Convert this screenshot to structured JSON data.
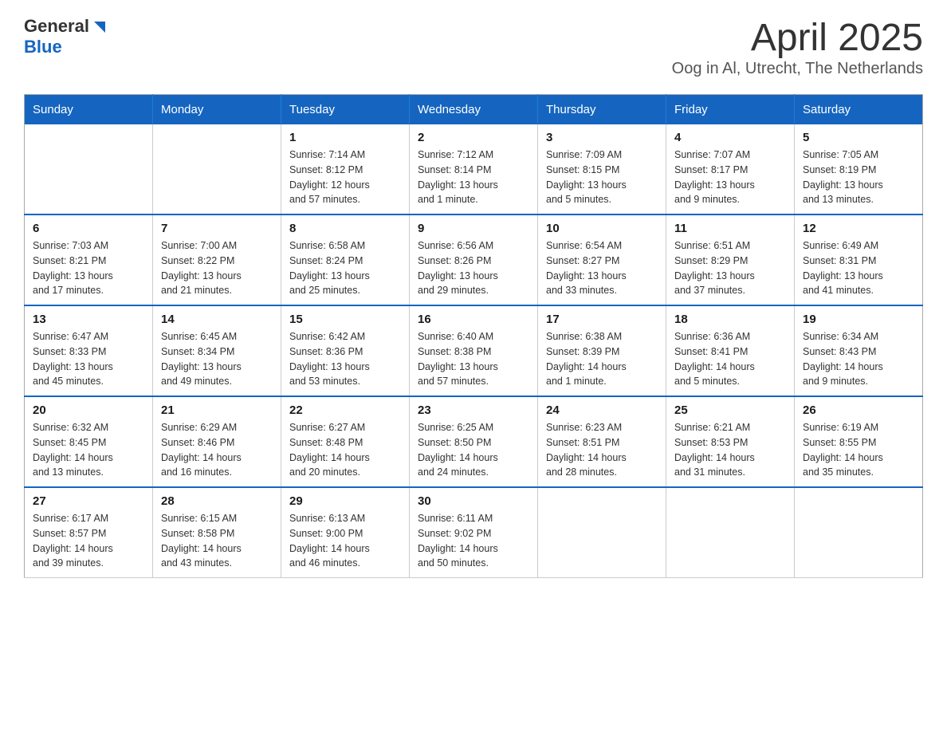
{
  "header": {
    "logo_general": "General",
    "logo_blue": "Blue",
    "main_title": "April 2025",
    "subtitle": "Oog in Al, Utrecht, The Netherlands"
  },
  "calendar": {
    "days_of_week": [
      "Sunday",
      "Monday",
      "Tuesday",
      "Wednesday",
      "Thursday",
      "Friday",
      "Saturday"
    ],
    "weeks": [
      [
        {
          "day": "",
          "info": ""
        },
        {
          "day": "",
          "info": ""
        },
        {
          "day": "1",
          "info": "Sunrise: 7:14 AM\nSunset: 8:12 PM\nDaylight: 12 hours\nand 57 minutes."
        },
        {
          "day": "2",
          "info": "Sunrise: 7:12 AM\nSunset: 8:14 PM\nDaylight: 13 hours\nand 1 minute."
        },
        {
          "day": "3",
          "info": "Sunrise: 7:09 AM\nSunset: 8:15 PM\nDaylight: 13 hours\nand 5 minutes."
        },
        {
          "day": "4",
          "info": "Sunrise: 7:07 AM\nSunset: 8:17 PM\nDaylight: 13 hours\nand 9 minutes."
        },
        {
          "day": "5",
          "info": "Sunrise: 7:05 AM\nSunset: 8:19 PM\nDaylight: 13 hours\nand 13 minutes."
        }
      ],
      [
        {
          "day": "6",
          "info": "Sunrise: 7:03 AM\nSunset: 8:21 PM\nDaylight: 13 hours\nand 17 minutes."
        },
        {
          "day": "7",
          "info": "Sunrise: 7:00 AM\nSunset: 8:22 PM\nDaylight: 13 hours\nand 21 minutes."
        },
        {
          "day": "8",
          "info": "Sunrise: 6:58 AM\nSunset: 8:24 PM\nDaylight: 13 hours\nand 25 minutes."
        },
        {
          "day": "9",
          "info": "Sunrise: 6:56 AM\nSunset: 8:26 PM\nDaylight: 13 hours\nand 29 minutes."
        },
        {
          "day": "10",
          "info": "Sunrise: 6:54 AM\nSunset: 8:27 PM\nDaylight: 13 hours\nand 33 minutes."
        },
        {
          "day": "11",
          "info": "Sunrise: 6:51 AM\nSunset: 8:29 PM\nDaylight: 13 hours\nand 37 minutes."
        },
        {
          "day": "12",
          "info": "Sunrise: 6:49 AM\nSunset: 8:31 PM\nDaylight: 13 hours\nand 41 minutes."
        }
      ],
      [
        {
          "day": "13",
          "info": "Sunrise: 6:47 AM\nSunset: 8:33 PM\nDaylight: 13 hours\nand 45 minutes."
        },
        {
          "day": "14",
          "info": "Sunrise: 6:45 AM\nSunset: 8:34 PM\nDaylight: 13 hours\nand 49 minutes."
        },
        {
          "day": "15",
          "info": "Sunrise: 6:42 AM\nSunset: 8:36 PM\nDaylight: 13 hours\nand 53 minutes."
        },
        {
          "day": "16",
          "info": "Sunrise: 6:40 AM\nSunset: 8:38 PM\nDaylight: 13 hours\nand 57 minutes."
        },
        {
          "day": "17",
          "info": "Sunrise: 6:38 AM\nSunset: 8:39 PM\nDaylight: 14 hours\nand 1 minute."
        },
        {
          "day": "18",
          "info": "Sunrise: 6:36 AM\nSunset: 8:41 PM\nDaylight: 14 hours\nand 5 minutes."
        },
        {
          "day": "19",
          "info": "Sunrise: 6:34 AM\nSunset: 8:43 PM\nDaylight: 14 hours\nand 9 minutes."
        }
      ],
      [
        {
          "day": "20",
          "info": "Sunrise: 6:32 AM\nSunset: 8:45 PM\nDaylight: 14 hours\nand 13 minutes."
        },
        {
          "day": "21",
          "info": "Sunrise: 6:29 AM\nSunset: 8:46 PM\nDaylight: 14 hours\nand 16 minutes."
        },
        {
          "day": "22",
          "info": "Sunrise: 6:27 AM\nSunset: 8:48 PM\nDaylight: 14 hours\nand 20 minutes."
        },
        {
          "day": "23",
          "info": "Sunrise: 6:25 AM\nSunset: 8:50 PM\nDaylight: 14 hours\nand 24 minutes."
        },
        {
          "day": "24",
          "info": "Sunrise: 6:23 AM\nSunset: 8:51 PM\nDaylight: 14 hours\nand 28 minutes."
        },
        {
          "day": "25",
          "info": "Sunrise: 6:21 AM\nSunset: 8:53 PM\nDaylight: 14 hours\nand 31 minutes."
        },
        {
          "day": "26",
          "info": "Sunrise: 6:19 AM\nSunset: 8:55 PM\nDaylight: 14 hours\nand 35 minutes."
        }
      ],
      [
        {
          "day": "27",
          "info": "Sunrise: 6:17 AM\nSunset: 8:57 PM\nDaylight: 14 hours\nand 39 minutes."
        },
        {
          "day": "28",
          "info": "Sunrise: 6:15 AM\nSunset: 8:58 PM\nDaylight: 14 hours\nand 43 minutes."
        },
        {
          "day": "29",
          "info": "Sunrise: 6:13 AM\nSunset: 9:00 PM\nDaylight: 14 hours\nand 46 minutes."
        },
        {
          "day": "30",
          "info": "Sunrise: 6:11 AM\nSunset: 9:02 PM\nDaylight: 14 hours\nand 50 minutes."
        },
        {
          "day": "",
          "info": ""
        },
        {
          "day": "",
          "info": ""
        },
        {
          "day": "",
          "info": ""
        }
      ]
    ]
  }
}
